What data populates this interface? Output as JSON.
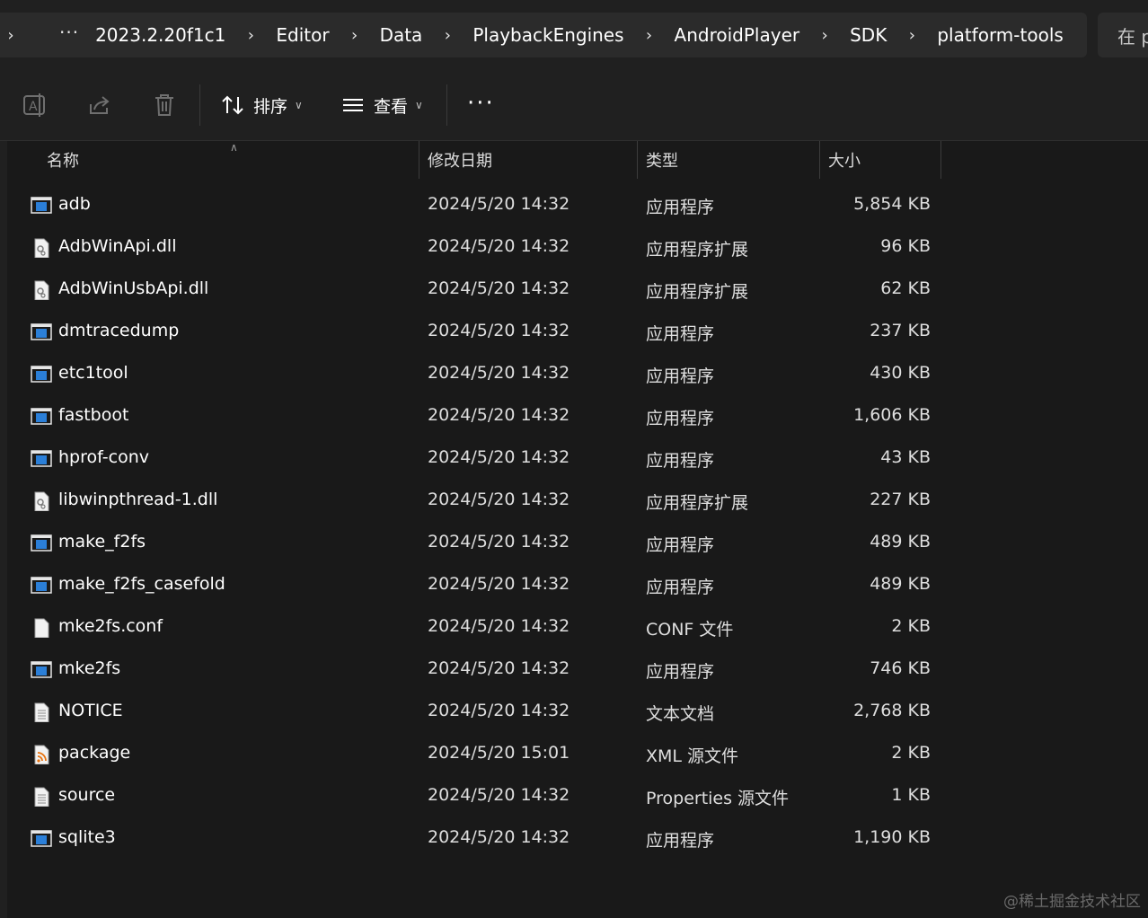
{
  "breadcrumb": {
    "more": "···",
    "items": [
      "2023.2.20f1c1",
      "Editor",
      "Data",
      "PlaybackEngines",
      "AndroidPlayer",
      "SDK",
      "platform-tools"
    ]
  },
  "search": {
    "placeholder": "在 p"
  },
  "toolbar": {
    "sort_label": "排序",
    "view_label": "查看",
    "more_label": "···"
  },
  "columns": {
    "name": "名称",
    "date": "修改日期",
    "type": "类型",
    "size": "大小"
  },
  "files": [
    {
      "name": "adb",
      "date": "2024/5/20 14:32",
      "type": "应用程序",
      "size": "5,854 KB",
      "icon": "exe"
    },
    {
      "name": "AdbWinApi.dll",
      "date": "2024/5/20 14:32",
      "type": "应用程序扩展",
      "size": "96 KB",
      "icon": "dll"
    },
    {
      "name": "AdbWinUsbApi.dll",
      "date": "2024/5/20 14:32",
      "type": "应用程序扩展",
      "size": "62 KB",
      "icon": "dll"
    },
    {
      "name": "dmtracedump",
      "date": "2024/5/20 14:32",
      "type": "应用程序",
      "size": "237 KB",
      "icon": "exe"
    },
    {
      "name": "etc1tool",
      "date": "2024/5/20 14:32",
      "type": "应用程序",
      "size": "430 KB",
      "icon": "exe"
    },
    {
      "name": "fastboot",
      "date": "2024/5/20 14:32",
      "type": "应用程序",
      "size": "1,606 KB",
      "icon": "exe"
    },
    {
      "name": "hprof-conv",
      "date": "2024/5/20 14:32",
      "type": "应用程序",
      "size": "43 KB",
      "icon": "exe"
    },
    {
      "name": "libwinpthread-1.dll",
      "date": "2024/5/20 14:32",
      "type": "应用程序扩展",
      "size": "227 KB",
      "icon": "dll"
    },
    {
      "name": "make_f2fs",
      "date": "2024/5/20 14:32",
      "type": "应用程序",
      "size": "489 KB",
      "icon": "exe"
    },
    {
      "name": "make_f2fs_casefold",
      "date": "2024/5/20 14:32",
      "type": "应用程序",
      "size": "489 KB",
      "icon": "exe"
    },
    {
      "name": "mke2fs.conf",
      "date": "2024/5/20 14:32",
      "type": "CONF 文件",
      "size": "2 KB",
      "icon": "blank"
    },
    {
      "name": "mke2fs",
      "date": "2024/5/20 14:32",
      "type": "应用程序",
      "size": "746 KB",
      "icon": "exe"
    },
    {
      "name": "NOTICE",
      "date": "2024/5/20 14:32",
      "type": "文本文档",
      "size": "2,768 KB",
      "icon": "text"
    },
    {
      "name": "package",
      "date": "2024/5/20 15:01",
      "type": "XML 源文件",
      "size": "2 KB",
      "icon": "xml"
    },
    {
      "name": "source",
      "date": "2024/5/20 14:32",
      "type": "Properties 源文件",
      "size": "1 KB",
      "icon": "text"
    },
    {
      "name": "sqlite3",
      "date": "2024/5/20 14:32",
      "type": "应用程序",
      "size": "1,190 KB",
      "icon": "exe"
    }
  ],
  "watermark": "@稀土掘金技术社区"
}
